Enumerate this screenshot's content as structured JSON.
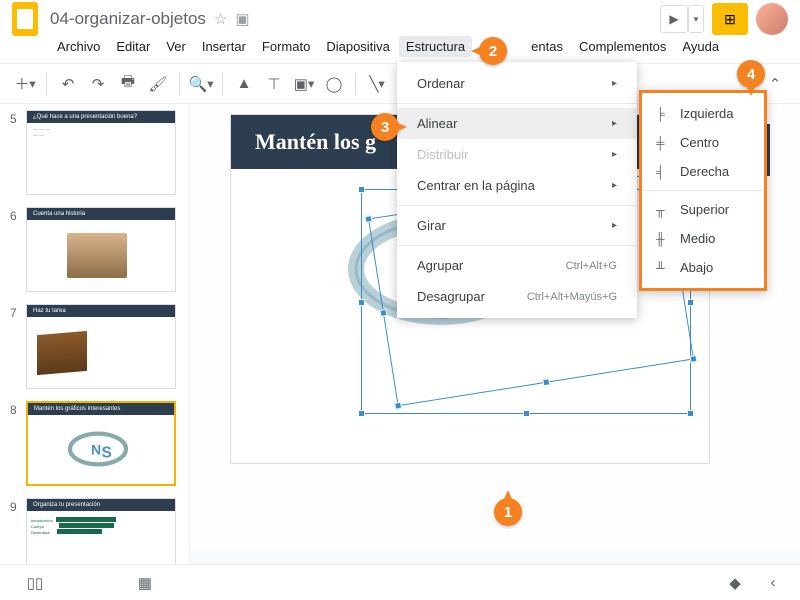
{
  "doc": {
    "title": "04-organizar-objetos"
  },
  "menus": {
    "archivo": "Archivo",
    "editar": "Editar",
    "ver": "Ver",
    "insertar": "Insertar",
    "formato": "Formato",
    "diapositiva": "Diapositiva",
    "estructura": "Estructura",
    "herramientas": "entas",
    "complementos": "Complementos",
    "ayuda": "Ayuda"
  },
  "dropdown": {
    "ordenar": "Ordenar",
    "alinear": "Alinear",
    "distribuir": "Distribuir",
    "centrar": "Centrar en la página",
    "girar": "Girar",
    "agrupar": "Agrupar",
    "desagrupar": "Desagrupar",
    "sc_agrupar": "Ctrl+Alt+G",
    "sc_desagrupar": "Ctrl+Alt+Mayús+G"
  },
  "submenu": {
    "izquierda": "Izquierda",
    "centro": "Centro",
    "derecha": "Derecha",
    "superior": "Superior",
    "medio": "Medio",
    "abajo": "Abajo"
  },
  "thumbs": {
    "n5": "5",
    "t5": "¿Qué hace a una presentación buena?",
    "n6": "6",
    "t6": "Cuenta una historia",
    "n7": "7",
    "t7": "Haz tu tarea",
    "n8": "8",
    "t8": "Mantén los gráficos interesantes",
    "n9": "9",
    "t9": "Organiza tu presentación"
  },
  "slide": {
    "title": "Mantén los g"
  },
  "callouts": {
    "c1": "1",
    "c2": "2",
    "c3": "3",
    "c4": "4"
  }
}
